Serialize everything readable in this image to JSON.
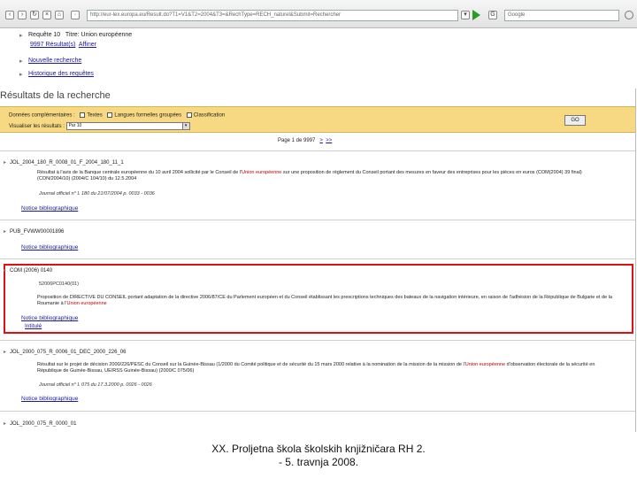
{
  "browser": {
    "address": "http://eur-lex.europa.eu/Result.do?T1=V1&T2=2004&T3=&RechType=RECH_naturel&Submit=Rechercher",
    "search_text": "Google",
    "icons": [
      "back-icon",
      "forward-icon",
      "reload-icon",
      "stop-icon",
      "home-icon",
      "go-icon",
      "search-icon"
    ]
  },
  "nav": {
    "request_label": "Requête 10",
    "request_criteria": "Titre: Union européenne",
    "results_count": "9997 Résultat(s)",
    "refine": "Affiner",
    "new_search": "Nouvelle recherche",
    "history": "Historique des requêtes"
  },
  "section_title": "Résultats de la recherche",
  "options": {
    "extra_data_label": "Données complémentaires :",
    "opt_texts": "Textes",
    "opt_relations": "Langues formelles groupées",
    "opt_class": "Classification",
    "display_label": "Visualiser les résultats :",
    "display_value": "Par 10",
    "go_label": "GO"
  },
  "pager": {
    "text": "Page 1 de 9997",
    "next": ">",
    "last": ">>"
  },
  "results": [
    {
      "id": "JOL_2004_180_R_0008_01_F_2004_180_11_1",
      "text_before": "Résultat à l'avis de la Banque centrale européenne du 10 avril 2004 sollicité par le Conseil de l'",
      "highlight": "Union européenne",
      "text_after": " sur une proposition de règlement du Conseil portant des mesures en faveur des entreprises pour les pièces en euros (COM(2004) 39 final) (CON/2004/10) (2004/C 104/10) du 12.5.2004",
      "meta": "Journal officiel n° L 180 du 21/07/2004 p. 0033 - 0036",
      "notice": "Notice bibliographique"
    },
    {
      "id": "PUB_FVWW00001896",
      "text_before": "",
      "highlight": "",
      "text_after": "",
      "meta": "",
      "notice": "Notice bibliographique"
    },
    {
      "id": "COM (2006) 0140",
      "sub": "52006PC0140(01)",
      "text_before": "Proposition de DIRECTIVE DU CONSEIL portant adaptation de la directive 2006/87/CE du Parlement européen et du Conseil établissant les prescriptions techniques des bateaux de la navigation intérieure, en raison de l'adhésion de la République de Bulgarie et de la Roumanie à l'",
      "highlight": "Union européenne",
      "text_after": "",
      "meta": "",
      "notice": "Notice bibliographique",
      "extra_link": "Intitulé"
    },
    {
      "id": "JOL_2000_075_R_0006_01_DEC_2000_226_06",
      "text_before": "Résultat sur le projet de décision 2000/226/PESC du Conseil sur la Guinée-Bissau (1/2000 du Comité politique et de sécurité du 15 mars 2000 relative à la nomination de la mission de la mission de l'",
      "highlight": "Union européenne",
      "text_after": " d'observation électorale de la sécurité en République de Guinée-Bissau, UE/RSS Guinée-Bissau) (2000/C 075/06)",
      "meta": "Journal officiel n° L 075 du 17.3.2000 p. 0026 - 0026",
      "notice": "Notice bibliographique"
    },
    {
      "id": "JOL_2000_075_R_0000_01",
      "text_before": "",
      "highlight": "",
      "text_after": "",
      "meta": "",
      "notice": ""
    }
  ],
  "footer": {
    "line1": "XX. Proljetna škola školskih knjižničara RH 2.",
    "line2": "- 5. travnja 2008."
  }
}
